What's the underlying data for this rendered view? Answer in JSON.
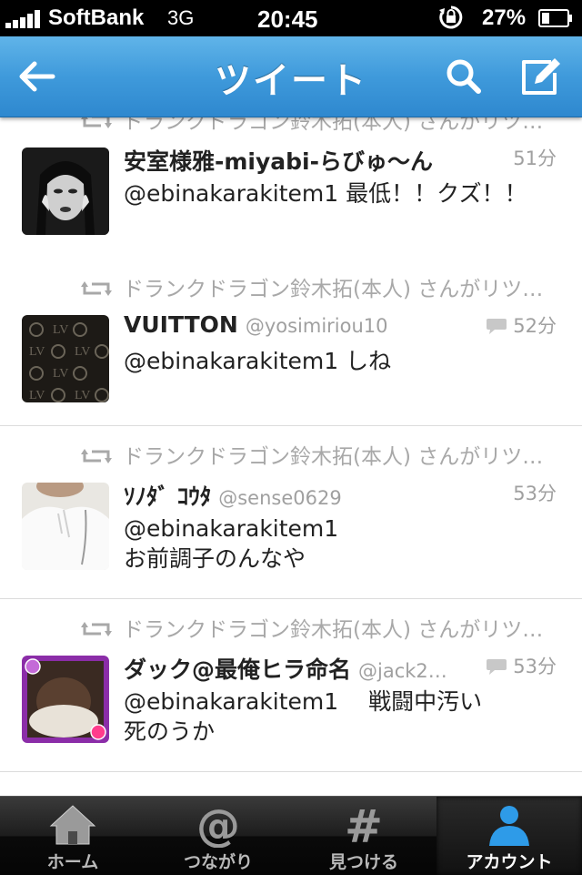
{
  "status_bar": {
    "carrier": "SoftBank",
    "network": "3G",
    "time": "20:45",
    "battery_percent": "27%"
  },
  "nav": {
    "title": "ツイート",
    "back_icon": "back-arrow-icon",
    "search_icon": "search-icon",
    "compose_icon": "compose-icon"
  },
  "colors": {
    "nav_blue": "#3f9adb",
    "text_gray": "#a0a0a0",
    "tab_active_blue": "#2e9be8"
  },
  "tweets": [
    {
      "retweet_text": "ドランクドラゴン鈴木拓(本人) さんがリツ…",
      "name": "安室様雅-miyabi-らびゅ〜ん",
      "handle": "",
      "time": "51分",
      "text": "@ebinakarakitem1 最低！！クズ！！"
    },
    {
      "retweet_text": "ドランクドラゴン鈴木拓(本人) さんがリツ…",
      "name": "VUITTON",
      "handle": "@yosimiriou10",
      "time": "52分",
      "text": "@ebinakarakitem1  しね"
    },
    {
      "retweet_text": "ドランクドラゴン鈴木拓(本人) さんがリツ…",
      "name": "ｿﾉﾀﾞ ｺｳﾀ",
      "handle": "@sense0629",
      "time": "53分",
      "text": "@ebinakarakitem1\nお前調子のんなや"
    },
    {
      "retweet_text": "ドランクドラゴン鈴木拓(本人) さんがリツ…",
      "name": "ダック@最俺ヒラ命名",
      "handle": "@jack2…",
      "time": "53分",
      "text": "@ebinakarakitem1　 戦闘中汚い\n死のうか"
    }
  ],
  "tabs": [
    {
      "label": "ホーム",
      "icon": "home-icon"
    },
    {
      "label": "つながり",
      "icon": "at-icon"
    },
    {
      "label": "見つける",
      "icon": "hash-icon"
    },
    {
      "label": "アカウント",
      "icon": "person-icon"
    }
  ]
}
